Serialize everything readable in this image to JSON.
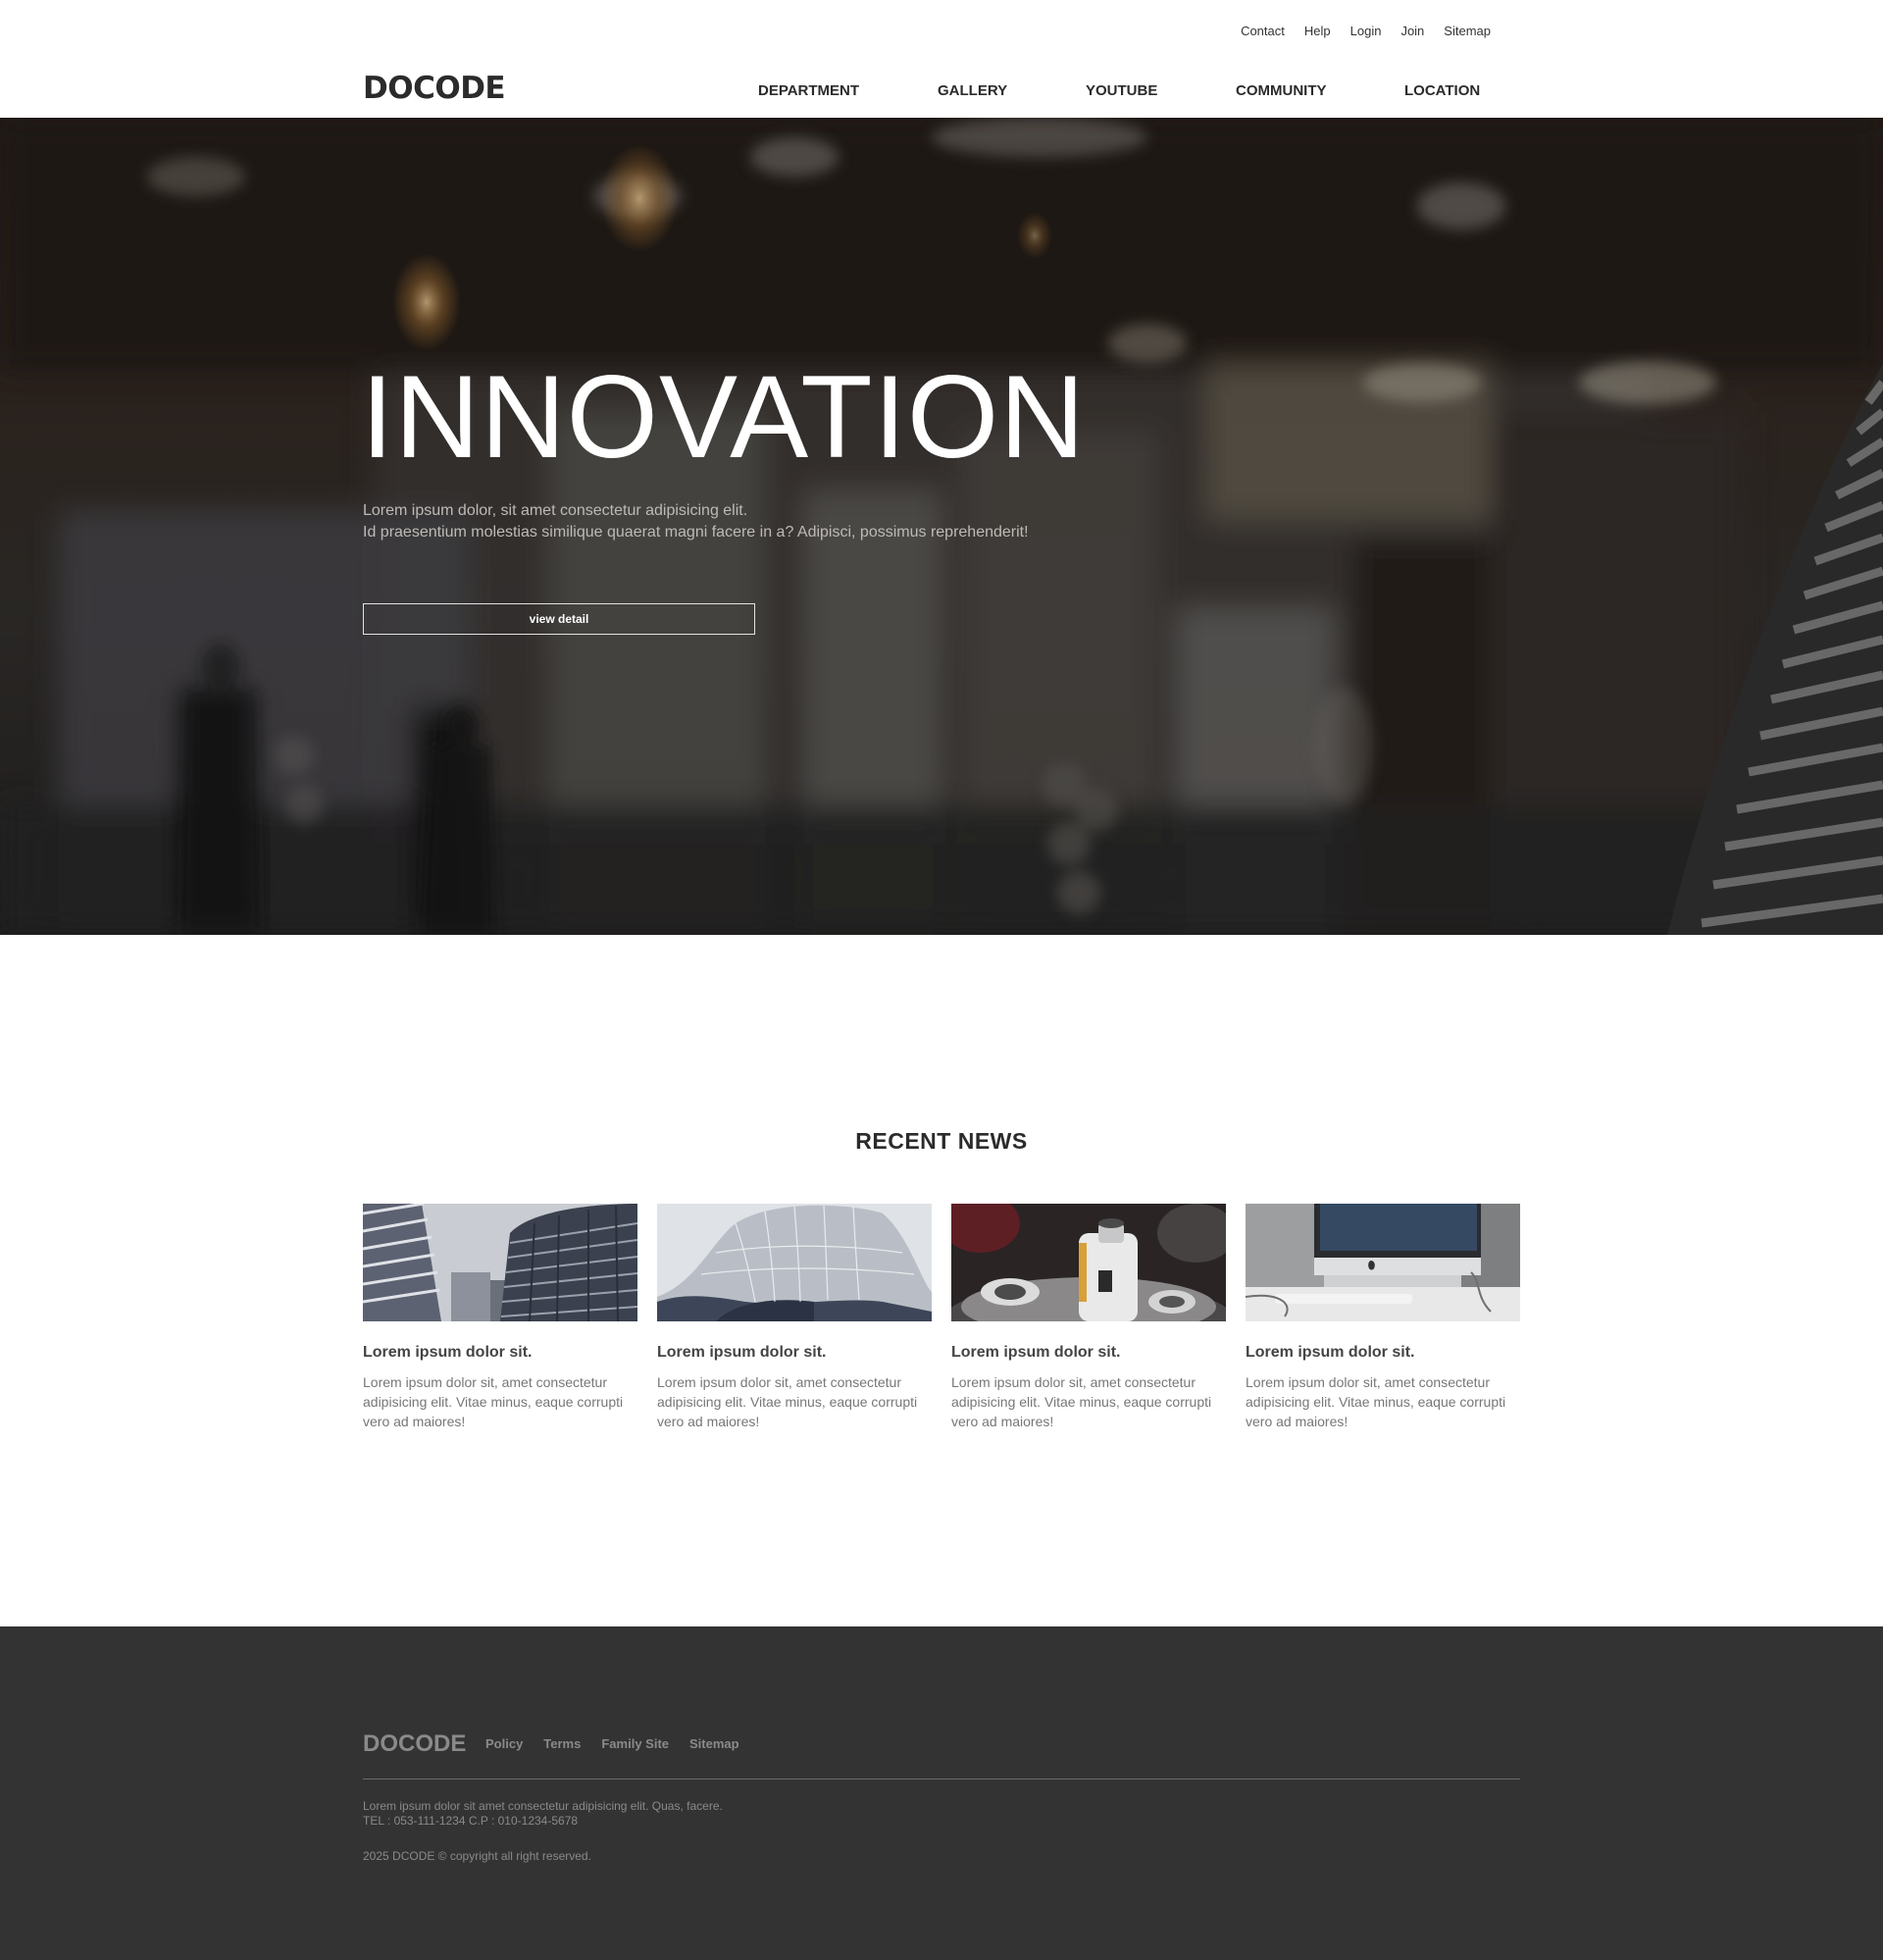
{
  "header": {
    "logo": "DOCODE",
    "util_links": [
      "Contact",
      "Help",
      "Login",
      "Join",
      "Sitemap"
    ],
    "gnb": [
      "DEPARTMENT",
      "GALLERY",
      "YOUTUBE",
      "COMMUNITY",
      "LOCATION"
    ]
  },
  "hero": {
    "title": "INNOVATION",
    "desc_line1": "Lorem ipsum dolor, sit amet consectetur adipisicing elit.",
    "desc_line2": "Id praesentium molestias similique quaerat magni facere in a? Adipisci, possimus reprehenderit!",
    "button": "view detail"
  },
  "news": {
    "title": "RECENT NEWS",
    "items": [
      {
        "thumb": "buildings-image",
        "head": "Lorem ipsum dolor sit.",
        "body": "Lorem ipsum dolor sit, amet consectetur adipisicing elit. Vitae minus, eaque corrupti vero ad maiores!"
      },
      {
        "thumb": "architecture-image",
        "head": "Lorem ipsum dolor sit.",
        "body": "Lorem ipsum dolor sit, amet consectetur adipisicing elit. Vitae minus, eaque corrupti vero ad maiores!"
      },
      {
        "thumb": "bottles-image",
        "head": "Lorem ipsum dolor sit.",
        "body": "Lorem ipsum dolor sit, amet consectetur adipisicing elit. Vitae minus, eaque corrupti vero ad maiores!"
      },
      {
        "thumb": "desk-computer-image",
        "head": "Lorem ipsum dolor sit.",
        "body": "Lorem ipsum dolor sit, amet consectetur adipisicing elit. Vitae minus, eaque corrupti vero ad maiores!"
      }
    ]
  },
  "footer": {
    "logo": "DOCODE",
    "links": [
      "Policy",
      "Terms",
      "Family Site",
      "Sitemap"
    ],
    "info_line1": "Lorem ipsum dolor sit amet consectetur adipisicing elit. Quas, facere.",
    "info_line2": "TEL : 053-111-1234 C.P : 010-1234-5678",
    "copyright": "2025 DCODE © copyright all right reserved."
  },
  "colors": {
    "footer_bg": "#333333",
    "text_dark": "#2b2b2b",
    "muted": "#8a8a8a"
  }
}
